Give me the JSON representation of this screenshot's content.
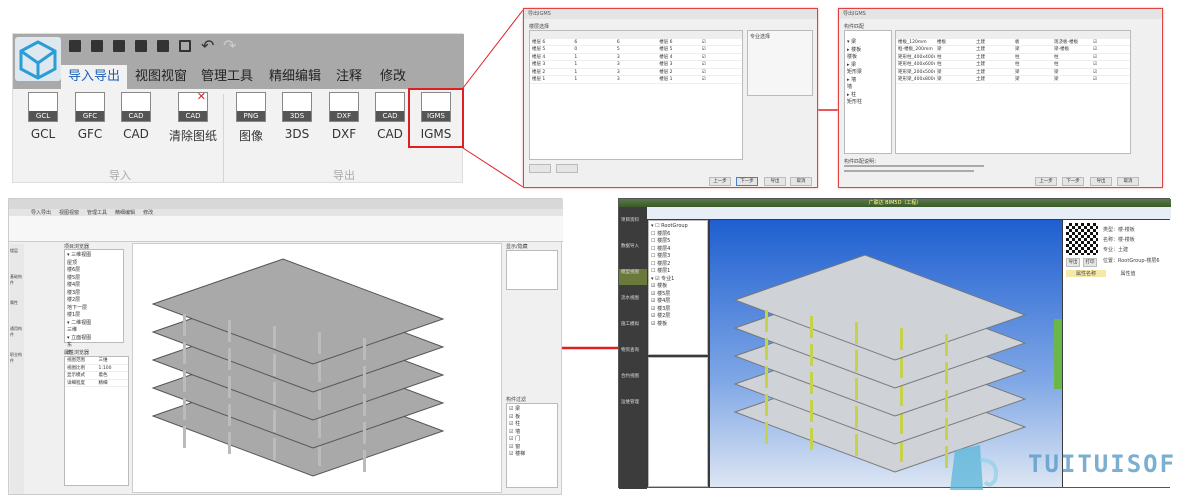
{
  "ribbon": {
    "tabs": [
      "导入导出",
      "视图视窗",
      "管理工具",
      "精细编辑",
      "注释",
      "修改"
    ],
    "active_tab": "导入导出",
    "import_buttons": [
      {
        "label": "GCL",
        "badge": "GCL"
      },
      {
        "label": "GFC",
        "badge": "GFC"
      },
      {
        "label": "CAD",
        "badge": "CAD"
      },
      {
        "label": "清除图纸",
        "badge": "CAD"
      }
    ],
    "export_buttons": [
      {
        "label": "图像",
        "badge": "PNG"
      },
      {
        "label": "3DS",
        "badge": "3DS"
      },
      {
        "label": "DXF",
        "badge": "DXF"
      },
      {
        "label": "CAD",
        "badge": "CAD"
      },
      {
        "label": "IGMS",
        "badge": "IGMS"
      }
    ],
    "group_import": "导入",
    "group_export": "导出",
    "highlight_color": "#e02020"
  },
  "dialog1": {
    "title": "导出IGMS",
    "section": "楼层选择",
    "rows": [
      [
        "楼层 6",
        "6",
        "6",
        "楼层 6",
        "☑"
      ],
      [
        "楼层 5",
        "0",
        "5",
        "楼层 5",
        "☑"
      ],
      [
        "楼层 4",
        "1",
        "3",
        "楼层 4",
        "☑"
      ],
      [
        "楼层 3",
        "1",
        "3",
        "楼层 3",
        "☑"
      ],
      [
        "楼层 2",
        "1",
        "3",
        "楼层 2",
        "☑"
      ],
      [
        "楼层 1",
        "1",
        "3",
        "楼层 1",
        "☑"
      ]
    ],
    "side_title": "专业选择",
    "buttons": [
      "上一步",
      "下一步",
      "导出",
      "取消"
    ]
  },
  "dialog2": {
    "title": "导出IGMS",
    "section": "构件匹配",
    "tree": [
      "▾ 梁",
      "▸ 楼板",
      "楼板",
      "▸ 梁",
      "矩形梁",
      "▸ 墙",
      "墙",
      "▸ 柱",
      "矩形柱"
    ],
    "rows": [
      [
        "楼板_120mm",
        "楼板",
        "土建",
        "板",
        "现浇板-楼板",
        "☑"
      ],
      [
        "框-楼板_200mm",
        "梁",
        "土建",
        "梁",
        "梁-楼板",
        "☑"
      ],
      [
        "矩形柱_400x400mm",
        "柱",
        "土建",
        "柱",
        "柱",
        "☑"
      ],
      [
        "矩形柱_400x600mm",
        "柱",
        "土建",
        "柱",
        "柱",
        "☑"
      ],
      [
        "矩形梁_200x500mm",
        "梁",
        "土建",
        "梁",
        "梁",
        "☑"
      ],
      [
        "矩形梁_400x800mm",
        "梁",
        "土建",
        "梁",
        "梁",
        "☑"
      ]
    ],
    "notes_title": "构件匹配说明：",
    "buttons": [
      "上一步",
      "下一步",
      "导出",
      "取消"
    ]
  },
  "app_left": {
    "tabs": [
      "导入导出",
      "视图视窗",
      "管理工具",
      "精细编辑",
      "修改"
    ],
    "side_tabs": [
      "楼层",
      "基础构件",
      "属性",
      "通用构件",
      "职业构件"
    ],
    "tree_title": "项目浏览器",
    "tree": [
      "▾ 三维视图",
      "屋顶",
      "楼6层",
      "楼5层",
      "楼4层",
      "楼3层",
      "楼2层",
      "地下一层",
      "楼1层",
      "▾ 二维视图",
      "三维",
      "▾ 立面视图",
      "东",
      "南",
      "西",
      "北"
    ],
    "props_title": "属性浏览器",
    "props": [
      [
        "视图范围",
        "三维"
      ],
      [
        "视图比例",
        "1:100"
      ],
      [
        "显示模式",
        "着色"
      ],
      [
        "详细程度",
        "精细"
      ]
    ],
    "right_title": "显示/隐藏",
    "filter_title": "构件过滤",
    "filter": [
      "☑ 梁",
      "☑ 板",
      "☑ 柱",
      "☑ 墙",
      "☑ 门",
      "☑ 窗",
      "☑ 楼梯"
    ]
  },
  "app_right": {
    "title": "广联达 BIM5D（工程）",
    "nav": [
      "项目资料",
      "数据导入",
      "模型视图",
      "流水视图",
      "施工模拟",
      "物资查询",
      "合约视图",
      "运维管理"
    ],
    "tree_title": "视图",
    "tree": [
      "▾ ☐ RootGroup",
      "☐ 楼层6",
      "☐ 楼层5",
      "☐ 楼层4",
      "☐ 楼层3",
      "☐ 楼层2",
      "☐ 楼层1",
      "▾ ☑ 专业1",
      "☑ 楼板",
      "☑ 楼5层",
      "☑ 楼4层",
      "☑ 楼3层",
      "☑ 楼2层",
      "☑ 楼板"
    ],
    "props": [
      "类型：楼-楼板",
      "名称：楼-楼板",
      "专业：土建",
      "位置：RootGroup-楼层6"
    ],
    "attr_headers": [
      "属性名称",
      "属性值"
    ],
    "buttons": [
      "导出",
      "打印"
    ]
  },
  "watermark": "TUITUISOFT"
}
